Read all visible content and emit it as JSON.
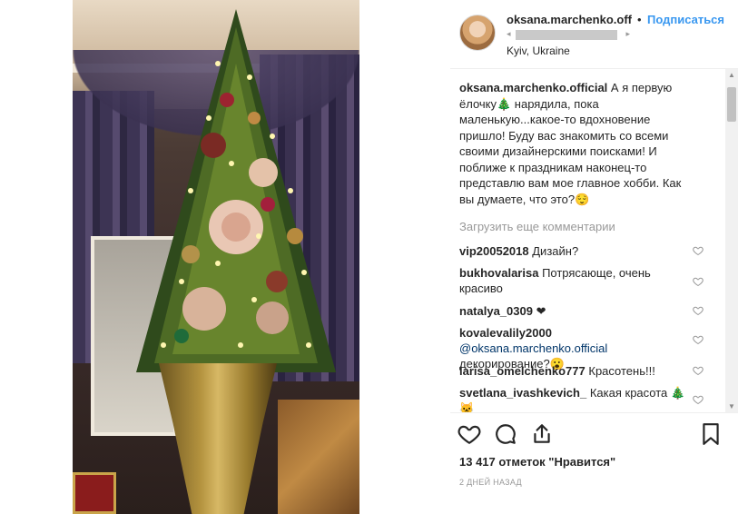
{
  "post": {
    "image_alt": "Decorated Christmas tree in a golden vase",
    "colors": {
      "link_blue": "#3897f0",
      "mention_blue": "#003569",
      "muted": "#999999",
      "text": "#262626"
    }
  },
  "header": {
    "username": "oksana.marchenko.off",
    "separator": "•",
    "follow_label": "Подписаться",
    "location": "Kyiv, Ukraine",
    "music_prev": "◂",
    "music_next": "▸"
  },
  "caption": {
    "username": "oksana.marchenko.official",
    "text": "А я первую ёлочку🎄 нарядила, пока маленькую...какое-то вдохновение пришло! Буду вас знакомить со всеми своими дизайнерскими поисками! И поближе к праздникам наконец-то представлю вам мое главное хобби. Как вы думаете, что это?😌"
  },
  "load_more_label": "Загрузить еще комментарии",
  "comments": [
    {
      "username": "vip20052018",
      "text": "Дизайн?"
    },
    {
      "username": "bukhovalarisa",
      "text": "Потрясающе, очень красиво"
    },
    {
      "username": "natalya_0309",
      "text": "❤"
    },
    {
      "username": "kovalevalily2000",
      "mention": "@oksana.marchenko.official",
      "text": "декорирование?😮"
    },
    {
      "username": "larisa_omelchenko777",
      "text": "Красотень!!!"
    },
    {
      "username": "svetlana_ivashkevich_",
      "text": "Какая красота 🎄🐱"
    }
  ],
  "actions": {
    "like_icon": "heart-icon",
    "comment_icon": "comment-icon",
    "share_icon": "share-icon",
    "save_icon": "bookmark-icon",
    "likes_text": "13 417 отметок \"Нравится\"",
    "timestamp": "2 дней назад"
  },
  "scrollbar": {
    "up": "▲",
    "down": "▼"
  }
}
